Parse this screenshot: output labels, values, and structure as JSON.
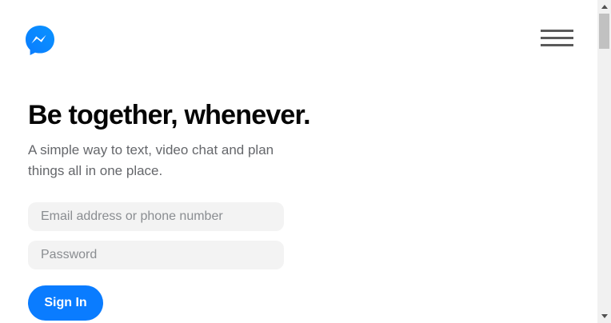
{
  "header": {
    "logo_icon": "messenger-logo-icon",
    "menu_icon": "hamburger-menu-icon"
  },
  "hero": {
    "title": "Be together, whenever.",
    "subtitle": "A simple way to text, video chat and plan things all in one place."
  },
  "login": {
    "email_placeholder": "Email address or phone number",
    "email_value": "",
    "password_placeholder": "Password",
    "password_value": "",
    "signin_label": "Sign In"
  },
  "colors": {
    "accent": "#0a7cff",
    "title": "#050505",
    "subtitle": "#65676b",
    "field_bg": "#f3f3f3"
  },
  "scrollbar": {
    "up_icon": "scroll-up-arrow-icon",
    "down_icon": "scroll-down-arrow-icon"
  }
}
